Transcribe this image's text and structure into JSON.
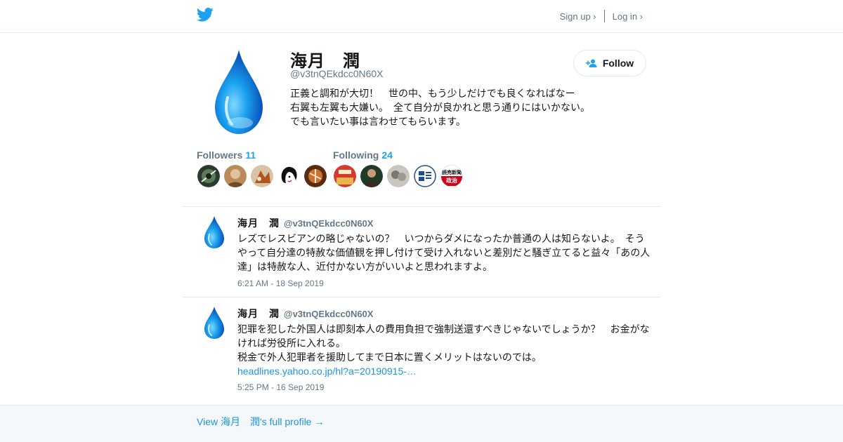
{
  "header": {
    "logo_icon": "twitter-bird-icon",
    "brand_color": "#1da1f2",
    "signup_label": "Sign up ›",
    "login_label": "Log in ›"
  },
  "profile": {
    "avatar_icon": "water-drop-avatar",
    "name": "海月　潤",
    "handle": "@v3tnQEkdcc0N60X",
    "bio": "正義と調和が大切！　世の中、もう少しだけでも良くなればなー　右翼も左翼も大嫌い。　全て自分が良かれと思う通りにはいかない。　でも言いたい事は言わせてもらいます。",
    "follow_label": "Follow",
    "follow_icon": "add-user-icon",
    "followers_label": "Followers",
    "followers_count": "11",
    "following_label": "Following",
    "following_count": "24",
    "yomiuri_logo_text_top": "読売新聞",
    "yomiuri_logo_text_bottom": "政治"
  },
  "tweets": [
    {
      "name": "海月　潤",
      "handle": "@v3tnQEkdcc0N60X",
      "text": "レズでレスビアンの略じゃないの？　いつからダメになったか普通の人は知らないよ。　そうやって自分達の特赦な価値観を押し付けて受け入れないと差別だと騒ぎ立てると益々「あの人達」は特赦な人、近付かない方がいいよと思われますよ。",
      "time": "6:21 AM - 18 Sep 2019"
    },
    {
      "name": "海月　潤",
      "handle": "@v3tnQEkdcc0N60X",
      "text_line1": "犯罪を犯した外国人は即刻本人の費用負担で強制送還すべきじゃないでしょうか？　お金がなければ労役所に入れる。",
      "text_line2": "税金で外人犯罪者を援助してまで日本に置くメリットはないのでは。",
      "link": "headlines.yahoo.co.jp/hl?a=20190915-…",
      "time": "5:25 PM - 16 Sep 2019"
    }
  ],
  "footer": {
    "full_profile_label": "View 海月　潤's full profile →"
  }
}
